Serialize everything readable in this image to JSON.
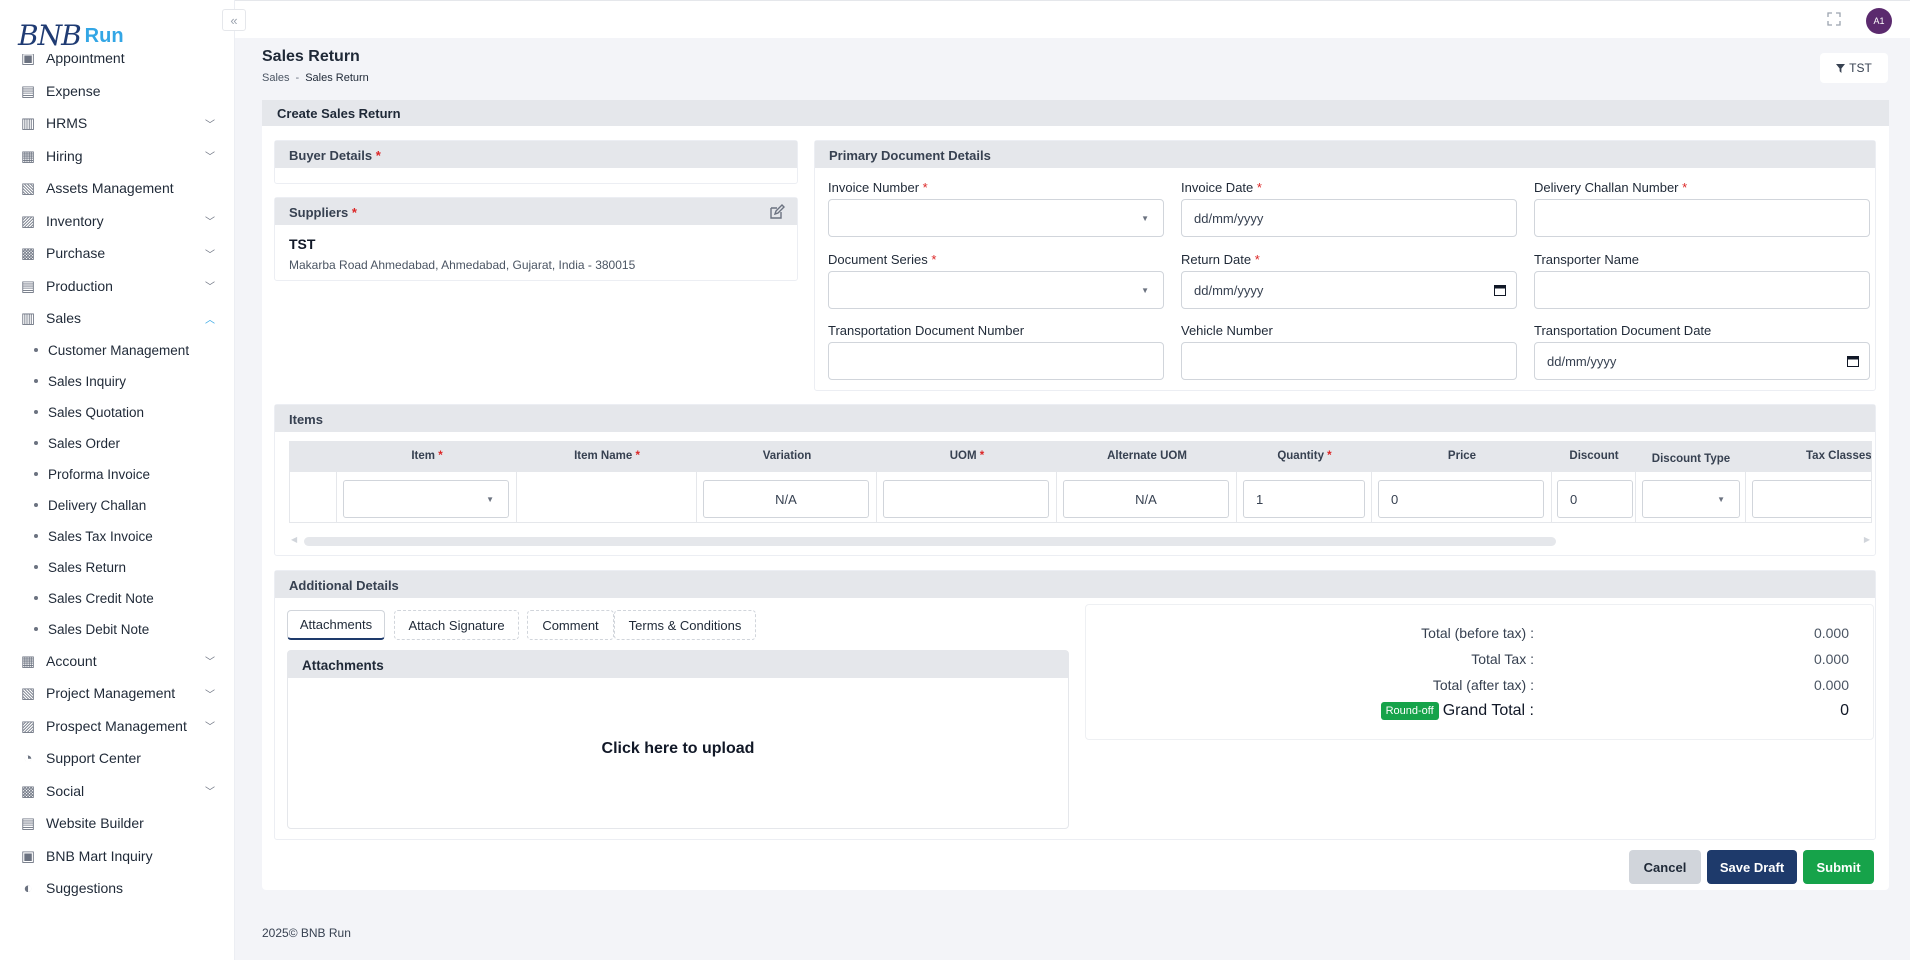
{
  "brand": {
    "logo_main": "BNB",
    "logo_sub": "Run"
  },
  "sidebar": {
    "items": [
      {
        "label": "Appointment",
        "icon": "calendar-check-icon",
        "expandable": false
      },
      {
        "label": "Expense",
        "icon": "receipt-icon",
        "expandable": false
      },
      {
        "label": "HRMS",
        "icon": "people-icon",
        "expandable": true
      },
      {
        "label": "Hiring",
        "icon": "hiring-icon",
        "expandable": true
      },
      {
        "label": "Assets Management",
        "icon": "assets-icon",
        "expandable": false
      },
      {
        "label": "Inventory",
        "icon": "inventory-icon",
        "expandable": true
      },
      {
        "label": "Purchase",
        "icon": "cart-icon",
        "expandable": true
      },
      {
        "label": "Production",
        "icon": "factory-icon",
        "expandable": true
      },
      {
        "label": "Sales",
        "icon": "sales-icon",
        "expandable": true,
        "open": true
      }
    ],
    "sales_sub": [
      "Customer Management",
      "Sales Inquiry",
      "Sales Quotation",
      "Sales Order",
      "Proforma Invoice",
      "Delivery Challan",
      "Sales Tax Invoice",
      "Sales Return",
      "Sales Credit Note",
      "Sales Debit Note"
    ],
    "items_after": [
      {
        "label": "Account",
        "icon": "bank-icon",
        "expandable": true
      },
      {
        "label": "Project Management",
        "icon": "project-icon",
        "expandable": true
      },
      {
        "label": "Prospect Management",
        "icon": "prospect-icon",
        "expandable": true
      },
      {
        "label": "Support Center",
        "icon": "support-icon",
        "expandable": false
      },
      {
        "label": "Social",
        "icon": "social-icon",
        "expandable": true
      },
      {
        "label": "Website Builder",
        "icon": "website-icon",
        "expandable": false
      },
      {
        "label": "BNB Mart Inquiry",
        "icon": "mart-icon",
        "expandable": false
      },
      {
        "label": "Suggestions",
        "icon": "toggle-icon",
        "expandable": false
      }
    ]
  },
  "topbar": {
    "avatar_initials": "A1"
  },
  "page": {
    "title": "Sales Return",
    "breadcrumb": {
      "parent": "Sales",
      "separator": "-",
      "current": "Sales Return"
    },
    "filter_label": "TST"
  },
  "form": {
    "card_title": "Create Sales Return",
    "buyer": {
      "title": "Buyer Details",
      "required": "*"
    },
    "suppliers": {
      "title": "Suppliers",
      "required": "*",
      "name": "TST",
      "address": "Makarba Road Ahmedabad, Ahmedabad, Gujarat, India - 380015"
    },
    "primary": {
      "title": "Primary Document Details",
      "invoice_number_label": "Invoice Number",
      "invoice_date_label": "Invoice Date",
      "invoice_date_placeholder": "dd/mm/yyyy",
      "delivery_challan_label": "Delivery Challan Number",
      "document_series_label": "Document Series",
      "return_date_label": "Return Date",
      "return_date_placeholder": "dd/mm/yyyy",
      "transporter_name_label": "Transporter Name",
      "transport_doc_number_label": "Transportation Document Number",
      "vehicle_number_label": "Vehicle Number",
      "transport_doc_date_label": "Transportation Document Date",
      "transport_doc_date_placeholder": "dd/mm/yyyy",
      "required": "*"
    },
    "items": {
      "title": "Items",
      "columns": {
        "item": "Item",
        "item_name": "Item Name",
        "variation": "Variation",
        "uom": "UOM",
        "alternate_uom": "Alternate UOM",
        "quantity": "Quantity",
        "price": "Price",
        "discount": "Discount",
        "discount_type": "Discount Type",
        "tax_classes": "Tax Classes"
      },
      "row": {
        "variation": "N/A",
        "alternate_uom": "N/A",
        "quantity": "1",
        "price": "0",
        "discount": "0"
      }
    },
    "additional": {
      "title": "Additional Details",
      "tabs": [
        "Attachments",
        "Attach Signature",
        "Comment",
        "Terms & Conditions"
      ],
      "attachments_title": "Attachments",
      "upload_text": "Click here to upload"
    },
    "totals": {
      "before_tax_label": "Total (before tax) :",
      "before_tax_value": "0.000",
      "tax_label": "Total Tax :",
      "tax_value": "0.000",
      "after_tax_label": "Total (after tax) :",
      "after_tax_value": "0.000",
      "round_off_badge": "Round-off",
      "grand_total_label": "Grand Total :",
      "grand_total_value": "0"
    },
    "actions": {
      "cancel": "Cancel",
      "save_draft": "Save Draft",
      "submit": "Submit"
    }
  },
  "footer": {
    "text": "2025© BNB Run"
  },
  "colors": {
    "primary": "#1e3a6b",
    "success": "#16a34a",
    "required": "#dc2626",
    "accent": "#33a6e5"
  }
}
